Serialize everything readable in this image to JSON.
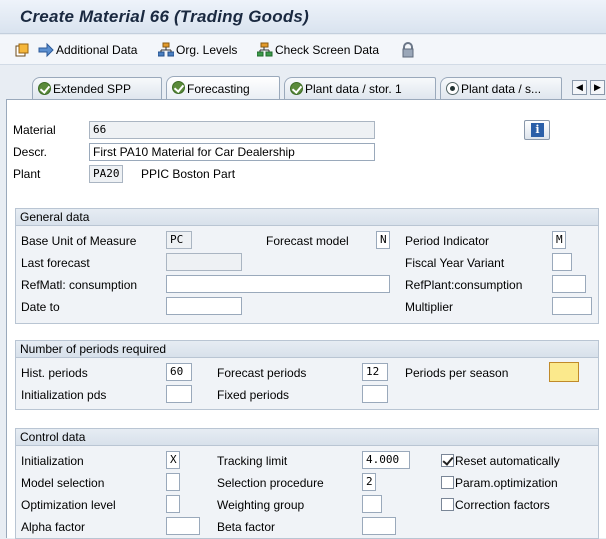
{
  "window": {
    "title": "Create Material 66 (Trading Goods)"
  },
  "toolbar": {
    "additional_data": "Additional Data",
    "org_levels": "Org. Levels",
    "check_screen_data": "Check Screen Data"
  },
  "tabs": [
    {
      "label": "Extended SPP",
      "state": "checked"
    },
    {
      "label": "Forecasting",
      "state": "checked",
      "active": true
    },
    {
      "label": "Plant data / stor. 1",
      "state": "checked"
    },
    {
      "label": "Plant data / s...",
      "state": "radio"
    }
  ],
  "header": {
    "material_label": "Material",
    "material_value": "66",
    "descr_label": "Descr.",
    "descr_value": "First PA10 Material for Car Dealership",
    "plant_label": "Plant",
    "plant_code": "PA20",
    "plant_name": "PPIC Boston Part"
  },
  "general": {
    "title": "General data",
    "base_uom_label": "Base Unit of Measure",
    "base_uom_value": "PC",
    "forecast_model_label": "Forecast model",
    "forecast_model_value": "N",
    "period_indicator_label": "Period Indicator",
    "period_indicator_value": "M",
    "last_forecast_label": "Last forecast",
    "last_forecast_value": "",
    "fiscal_year_variant_label": "Fiscal Year Variant",
    "fiscal_year_variant_value": "",
    "refmatl_label": "RefMatl: consumption",
    "refmatl_value": "",
    "refplant_label": "RefPlant:consumption",
    "refplant_value": "",
    "date_to_label": "Date to",
    "date_to_value": "",
    "multiplier_label": "Multiplier",
    "multiplier_value": ""
  },
  "periods": {
    "title": "Number of periods required",
    "hist_label": "Hist. periods",
    "hist_value": "60",
    "forecast_label": "Forecast periods",
    "forecast_value": "12",
    "per_season_label": "Periods per season",
    "per_season_value": "",
    "init_pds_label": "Initialization pds",
    "init_pds_value": "",
    "fixed_label": "Fixed periods",
    "fixed_value": ""
  },
  "control": {
    "title": "Control data",
    "initialization_label": "Initialization",
    "initialization_value": "X",
    "tracking_limit_label": "Tracking limit",
    "tracking_limit_value": "4.000",
    "reset_auto_label": "Reset automatically",
    "reset_auto_checked": true,
    "model_selection_label": "Model selection",
    "model_selection_value": "",
    "selection_proc_label": "Selection procedure",
    "selection_proc_value": "2",
    "param_opt_label": "Param.optimization",
    "param_opt_checked": false,
    "opt_level_label": "Optimization level",
    "opt_level_value": "",
    "weighting_label": "Weighting group",
    "weighting_value": "",
    "correction_label": "Correction factors",
    "correction_checked": false,
    "alpha_label": "Alpha factor",
    "alpha_value": "",
    "beta_label": "Beta factor",
    "beta_value": ""
  }
}
